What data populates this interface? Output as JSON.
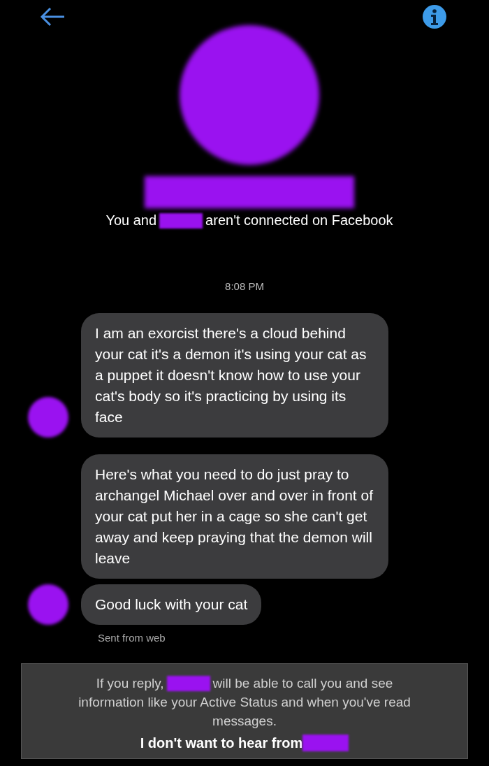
{
  "notice": {
    "before": "You and",
    "after": "aren't connected on Facebook"
  },
  "timestamp": "8:08 PM",
  "messages": [
    {
      "text": "I am an exorcist there's a cloud behind your cat it's a demon it's using your cat as a puppet it doesn't know how to use your cat's body so it's practicing by using its face",
      "show_avatar": true
    },
    {
      "text": "Here's what you need to do just pray to archangel Michael over and over in front of your cat put her in a cage so she can't get away and keep praying that the demon will leave",
      "show_avatar": false
    },
    {
      "text": "Good luck with your cat",
      "show_avatar": true
    }
  ],
  "sent_note": "Sent from web",
  "reply_notice": {
    "before": "If you reply,",
    "after": "will be able to call you and see",
    "continuation": "information like your Active Status and when you've read messages.",
    "action": "I don't want to hear from"
  }
}
